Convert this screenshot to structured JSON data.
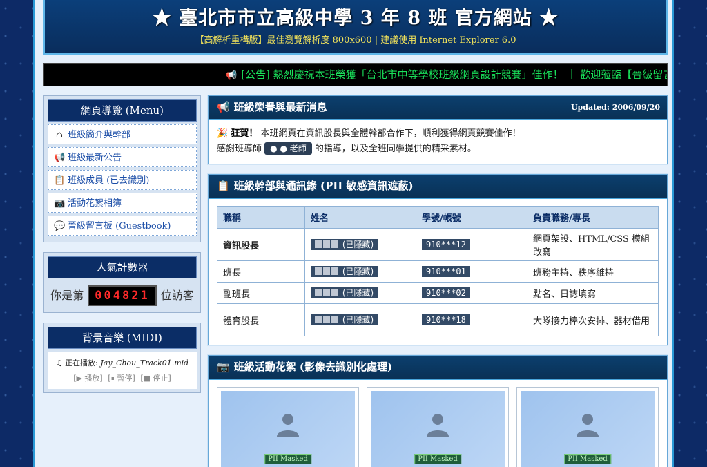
{
  "header": {
    "title": "★ 臺北市市立高級中學 3 年 8 班 官方網站 ★",
    "subtitle": "【高解析重構版】最佳瀏覽解析度 800x600 | 建議使用 Internet Explorer 6.0"
  },
  "marquee": {
    "text": "[公告] 熱烈慶祝本班榮獲「台北市中等學校班級網頁設計競賽」佳作！ ｜ 歡迎蒞臨【晉級留言"
  },
  "sidebar": {
    "nav_title": "網頁導覽 (Menu)",
    "nav_items": [
      {
        "icon": "house-icon",
        "glyph": "⌂",
        "label": "班級簡介與幹部"
      },
      {
        "icon": "megaphone-icon",
        "glyph": "📢",
        "label": "班級最新公告"
      },
      {
        "icon": "clipboard-icon",
        "glyph": "📋",
        "label": "班級成員 (已去識別)"
      },
      {
        "icon": "camera-icon",
        "glyph": "📷",
        "label": "活動花絮相簿"
      },
      {
        "icon": "speech-bubble-icon",
        "glyph": "💬",
        "label": "晉級留言板 (Guestbook)"
      }
    ],
    "counter_title": "人氣計數器",
    "counter_prefix": "你是第",
    "counter_value": "004821",
    "counter_suffix": "位訪客",
    "music_title": "背景音樂 (MIDI)",
    "music_now_label": "正在播放:",
    "music_track": "Jay_Chou_Track01.mid",
    "music_play": "[▶ 播放]",
    "music_pause": "[⏸ 暫停]",
    "music_stop": "[■ 停止]"
  },
  "news": {
    "title": "班級榮譽與最新消息",
    "updated": "Updated: 2006/09/20",
    "congrats": "狂賀！",
    "line1": "本班網頁在資訊股長與全體幹部合作下，順利獲得網頁競賽佳作！",
    "line2_prefix": "感謝班導師",
    "teacher": "● ● 老師",
    "line2_suffix": "的指導，以及全班同學提供的精采素材。"
  },
  "roster": {
    "title": "班級幹部與通訊錄 (PII 敏感資訊遮蔽)",
    "headers": [
      "職稱",
      "姓名",
      "學號/帳號",
      "負責職務/專長"
    ],
    "rows": [
      {
        "role": "資訊股長",
        "name": "(已隱藏)",
        "id": "910***12",
        "duty": "網頁架設、HTML/CSS 模組改寫"
      },
      {
        "role": "班長",
        "name": "(已隱藏)",
        "id": "910***01",
        "duty": "班務主持、秩序維持"
      },
      {
        "role": "副班長",
        "name": "(已隱藏)",
        "id": "910***02",
        "duty": "點名、日誌填寫"
      },
      {
        "role": "體育股長",
        "name": "(已隱藏)",
        "id": "910***18",
        "duty": "大隊接力棒次安排、器材借用"
      }
    ]
  },
  "gallery": {
    "title": "班級活動花絮 (影像去識別化處理)",
    "photos": [
      {
        "tag": "PII Masked"
      },
      {
        "tag": "PII Masked"
      },
      {
        "tag": "PII Masked"
      }
    ]
  }
}
